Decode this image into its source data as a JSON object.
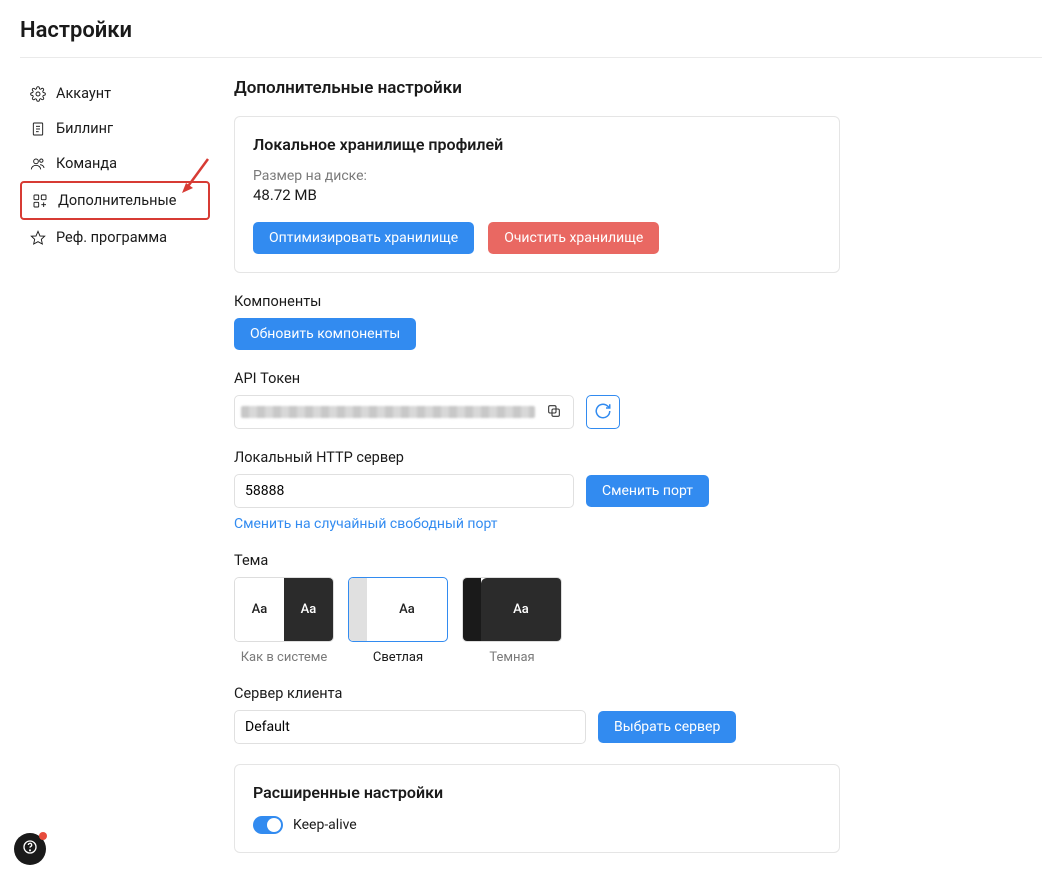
{
  "page_title": "Настройки",
  "sidebar": {
    "items": [
      {
        "label": "Аккаунт"
      },
      {
        "label": "Биллинг"
      },
      {
        "label": "Команда"
      },
      {
        "label": "Дополнительные"
      },
      {
        "label": "Реф. программа"
      }
    ]
  },
  "main": {
    "title": "Дополнительные настройки",
    "storage": {
      "title": "Локальное хранилище профилей",
      "size_label": "Размер на диске:",
      "size_value": "48.72 MB",
      "optimize_label": "Оптимизировать хранилище",
      "clear_label": "Очистить хранилище"
    },
    "components": {
      "label": "Компоненты",
      "update_label": "Обновить компоненты"
    },
    "api_token": {
      "label": "API Токен"
    },
    "http_server": {
      "label": "Локальный HTTP сервер",
      "port_value": "58888",
      "change_port_label": "Сменить порт",
      "random_port_link": "Сменить на случайный свободный порт"
    },
    "theme": {
      "label": "Тема",
      "options": [
        {
          "label": "Как в системе",
          "sample": "Aa"
        },
        {
          "label": "Светлая",
          "sample": "Aa"
        },
        {
          "label": "Темная",
          "sample": "Aa"
        }
      ]
    },
    "client_server": {
      "label": "Сервер клиента",
      "value": "Default",
      "choose_label": "Выбрать сервер"
    },
    "advanced": {
      "title": "Расширенные настройки",
      "keep_alive_label": "Keep-alive"
    }
  }
}
